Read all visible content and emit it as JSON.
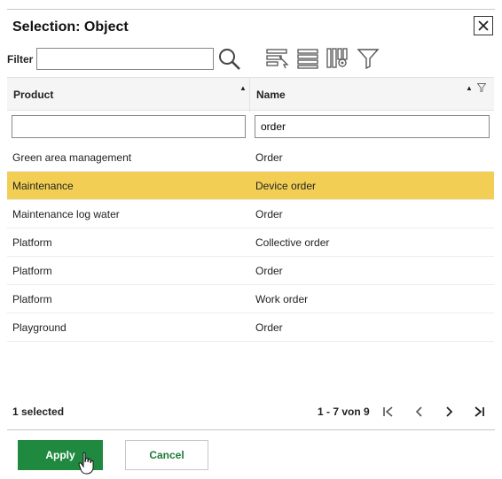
{
  "dialog": {
    "title": "Selection: Object"
  },
  "filter": {
    "label": "Filter",
    "value": ""
  },
  "toolbar": {
    "icons": [
      "search-icon",
      "select-rows-icon",
      "rows-list-icon",
      "column-settings-icon",
      "filter-funnel-icon"
    ]
  },
  "grid": {
    "columns": [
      {
        "label": "Product",
        "filter_value": ""
      },
      {
        "label": "Name",
        "filter_value": "order"
      }
    ],
    "rows": [
      {
        "product": "Green area management",
        "name": "Order"
      },
      {
        "product": "Maintenance",
        "name": "Device order"
      },
      {
        "product": "Maintenance log water",
        "name": "Order"
      },
      {
        "product": "Platform",
        "name": "Collective order"
      },
      {
        "product": "Platform",
        "name": "Order"
      },
      {
        "product": "Platform",
        "name": "Work order"
      },
      {
        "product": "Playground",
        "name": "Order"
      }
    ],
    "selected_row": 1,
    "selection_color": "#f2cf54"
  },
  "footer": {
    "selected_text": "1 selected",
    "range_text": "1 - 7 von 9"
  },
  "actions": {
    "apply_label": "Apply",
    "cancel_label": "Cancel",
    "apply_color": "#1f8a3f"
  }
}
